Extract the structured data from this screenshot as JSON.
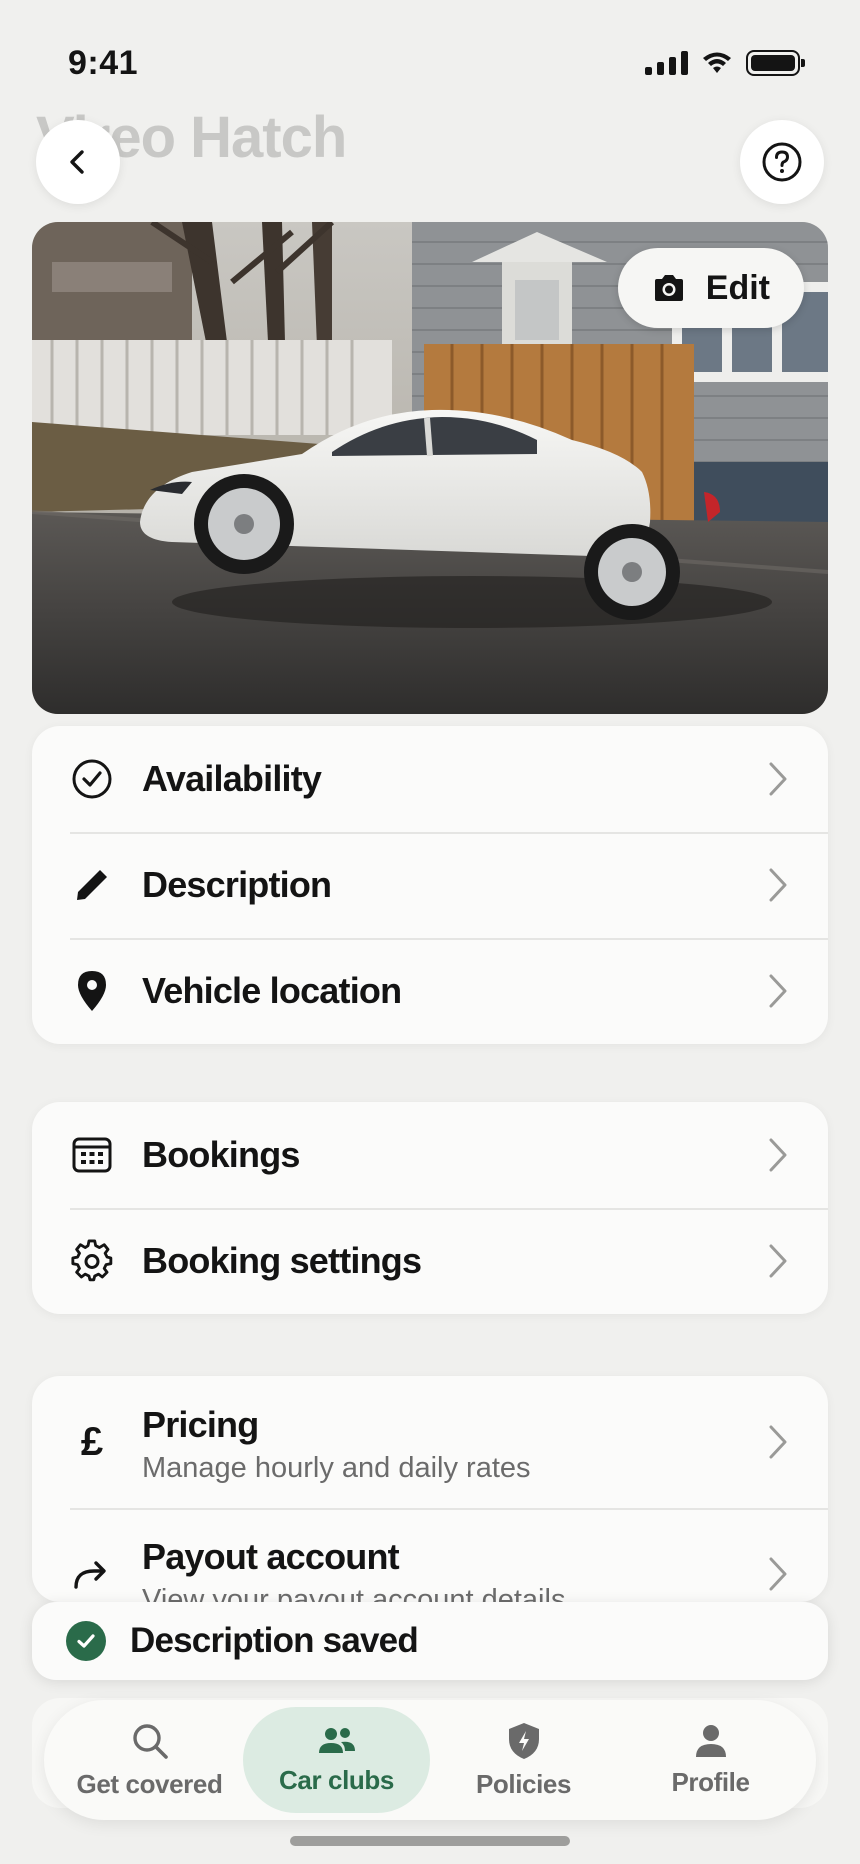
{
  "status_bar": {
    "time": "9:41"
  },
  "header": {
    "title": "Vireo Hatch"
  },
  "hero": {
    "edit_label": "Edit"
  },
  "groups": [
    {
      "items": [
        {
          "label": "Availability",
          "icon": "check-circle-icon"
        },
        {
          "label": "Description",
          "icon": "pencil-icon"
        },
        {
          "label": "Vehicle location",
          "icon": "location-pin-icon"
        }
      ]
    },
    {
      "items": [
        {
          "label": "Bookings",
          "icon": "calendar-icon"
        },
        {
          "label": "Booking settings",
          "icon": "gear-icon"
        }
      ]
    },
    {
      "items": [
        {
          "label": "Pricing",
          "subtitle": "Manage hourly and daily rates",
          "icon": "pound-icon"
        },
        {
          "label": "Payout account",
          "subtitle": "View your payout account details",
          "icon": "forward-arrow-icon"
        }
      ]
    }
  ],
  "toast": {
    "message": "Description saved"
  },
  "tabbar": {
    "active": "Car clubs",
    "accent": "#2a6b4a",
    "items": [
      {
        "label": "Get covered",
        "icon": "search-icon"
      },
      {
        "label": "Car clubs",
        "icon": "people-icon"
      },
      {
        "label": "Policies",
        "icon": "shield-icon"
      },
      {
        "label": "Profile",
        "icon": "person-icon"
      }
    ]
  }
}
